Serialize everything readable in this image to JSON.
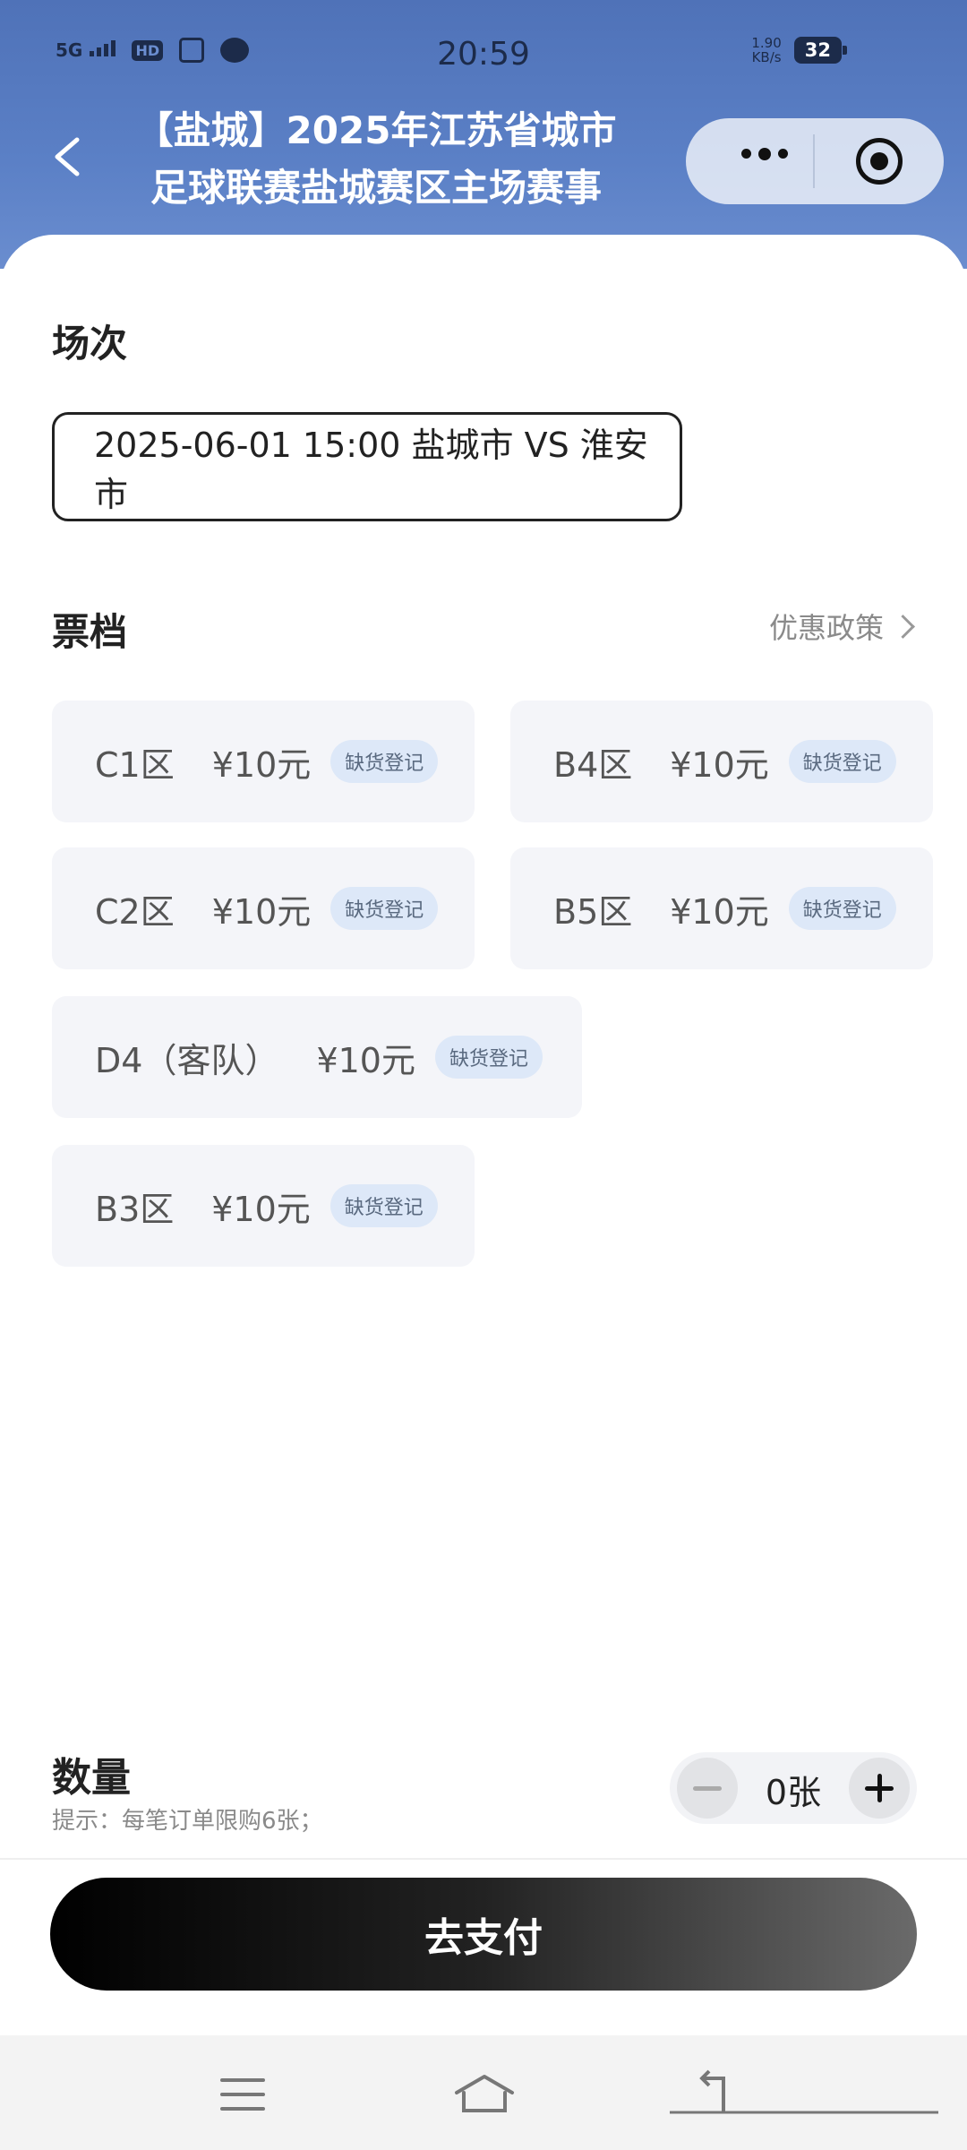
{
  "status_bar": {
    "network": "5G",
    "hd": "HD",
    "time": "20:59",
    "speed_value": "1.90",
    "speed_unit": "KB/s",
    "battery": "32"
  },
  "header": {
    "title_line1": "【盐城】2025年江苏省城市",
    "title_line2": "足球联赛盐城赛区主场赛事",
    "back_icon": "chevron-left-icon",
    "more_icon": "more-dots-icon",
    "close_icon": "target-icon"
  },
  "session": {
    "label": "场次",
    "selected": "2025-06-01 15:00 盐城市 VS 淮安市"
  },
  "tickets": {
    "label": "票档",
    "promo_link": "优惠政策",
    "items": [
      {
        "name": "C1区",
        "price": "¥10元",
        "badge": "缺货登记"
      },
      {
        "name": "B4区",
        "price": "¥10元",
        "badge": "缺货登记"
      },
      {
        "name": "C2区",
        "price": "¥10元",
        "badge": "缺货登记"
      },
      {
        "name": "B5区",
        "price": "¥10元",
        "badge": "缺货登记"
      },
      {
        "name": "D4（客队）",
        "price": "¥10元",
        "badge": "缺货登记"
      },
      {
        "name": "B3区",
        "price": "¥10元",
        "badge": "缺货登记"
      }
    ]
  },
  "quantity": {
    "label": "数量",
    "tip": "提示：每笔订单限购6张；",
    "value": "0张"
  },
  "pay_button": "去支付",
  "colors": {
    "header": "#5b80c6",
    "badge_bg": "#dde8f8",
    "card_bg": "#f4f5f9"
  }
}
